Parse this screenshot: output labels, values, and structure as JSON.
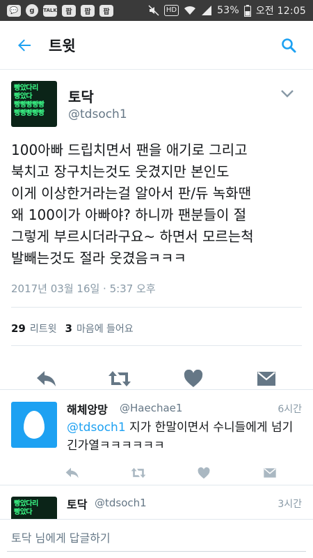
{
  "status_bar": {
    "app_icons": [
      "💬",
      "g",
      "TALK",
      "팝",
      "팝",
      "팝"
    ],
    "hd": "HD",
    "battery": "53%",
    "time": "오전 12:05"
  },
  "app_bar": {
    "title": "트윗",
    "back_icon": "arrow-left-icon",
    "search_icon": "search-icon"
  },
  "tweet": {
    "avatar_lines": [
      "빵았다리",
      "빵았다",
      "빵빵빵빵빵",
      "빵빵빵빵빵"
    ],
    "author_name": "토닥",
    "author_handle": "@tdsoch1",
    "text": "100아빠 드립치면서 팬을 애기로 그리고\n북치고 장구치는것도 웃겼지만 본인도\n이게 이상한거라는걸 알아서 판/듀 녹화땐\n왜 100이가 아빠야? 하니까 팬분들이 절\n그렇게 부르시더라구요~ 하면서 모르는척\n발빼는것도 절라 웃겼음ㅋㅋㅋ",
    "date": "2017년 03월 16일 · 5:37 오후",
    "retweet_count": "29",
    "retweet_label": "리트윗",
    "like_count": "3",
    "like_label": "마음에 들어요"
  },
  "reply": {
    "name": "해체앙망",
    "handle": "@Haechae1",
    "time": "6시간",
    "mention": "@tdsoch1",
    "text": " 지가 한말이면서 수니들에게 넘기긴가열ㅋㅋㅋㅋㅋㅋ"
  },
  "reply2": {
    "avatar_lines": [
      "빵았다리",
      "빵았다"
    ],
    "name": "토닥",
    "handle": "@tdsoch1",
    "time": "3시간"
  },
  "composer": {
    "placeholder": "토닥 님에게 답글하기"
  },
  "colors": {
    "accent": "#1da1f2",
    "text": "#14171a",
    "secondary": "#657786",
    "status_bar": "#3a3a3a",
    "action_icon": "#657786"
  }
}
